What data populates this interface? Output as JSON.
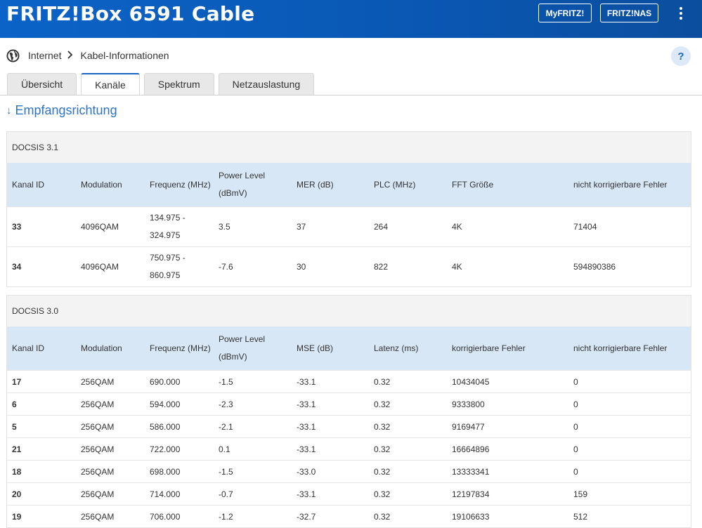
{
  "header": {
    "title": "FRITZ!Box 6591 Cable",
    "buttons": {
      "myfritz": "MyFRITZ!",
      "fritznas": "FRITZ!NAS"
    }
  },
  "breadcrumb": {
    "root": "Internet",
    "current": "Kabel-Informationen"
  },
  "help_label": "?",
  "tabs": [
    {
      "label": "Übersicht",
      "active": false
    },
    {
      "label": "Kanäle",
      "active": true
    },
    {
      "label": "Spektrum",
      "active": false
    },
    {
      "label": "Netzauslastung",
      "active": false
    }
  ],
  "section": {
    "title": "Empfangsrichtung"
  },
  "docsis31": {
    "title": "DOCSIS 3.1",
    "columns": [
      "Kanal ID",
      "Modulation",
      "Frequenz (MHz)",
      "Power Level (dBmV)",
      "MER (dB)",
      "PLC (MHz)",
      "FFT Größe",
      "nicht korrigierbare Fehler"
    ],
    "rows": [
      [
        "33",
        "4096QAM",
        "134.975 - 324.975",
        "3.5",
        "37",
        "264",
        "4K",
        "71404"
      ],
      [
        "34",
        "4096QAM",
        "750.975 - 860.975",
        "-7.6",
        "30",
        "822",
        "4K",
        "594890386"
      ]
    ]
  },
  "docsis30": {
    "title": "DOCSIS 3.0",
    "columns": [
      "Kanal ID",
      "Modulation",
      "Frequenz (MHz)",
      "Power Level (dBmV)",
      "MSE (dB)",
      "Latenz (ms)",
      "korrigierbare Fehler",
      "nicht korrigierbare Fehler"
    ],
    "rows": [
      [
        "17",
        "256QAM",
        "690.000",
        "-1.5",
        "-33.1",
        "0.32",
        "10434045",
        "0"
      ],
      [
        "6",
        "256QAM",
        "594.000",
        "-2.3",
        "-33.1",
        "0.32",
        "9333800",
        "0"
      ],
      [
        "5",
        "256QAM",
        "586.000",
        "-2.1",
        "-33.1",
        "0.32",
        "9169477",
        "0"
      ],
      [
        "21",
        "256QAM",
        "722.000",
        "0.1",
        "-33.1",
        "0.32",
        "16664896",
        "0"
      ],
      [
        "18",
        "256QAM",
        "698.000",
        "-1.5",
        "-33.0",
        "0.32",
        "13333341",
        "0"
      ],
      [
        "20",
        "256QAM",
        "714.000",
        "-0.7",
        "-33.1",
        "0.32",
        "12197834",
        "159"
      ],
      [
        "19",
        "256QAM",
        "706.000",
        "-1.2",
        "-32.7",
        "0.32",
        "19106633",
        "512"
      ]
    ]
  }
}
